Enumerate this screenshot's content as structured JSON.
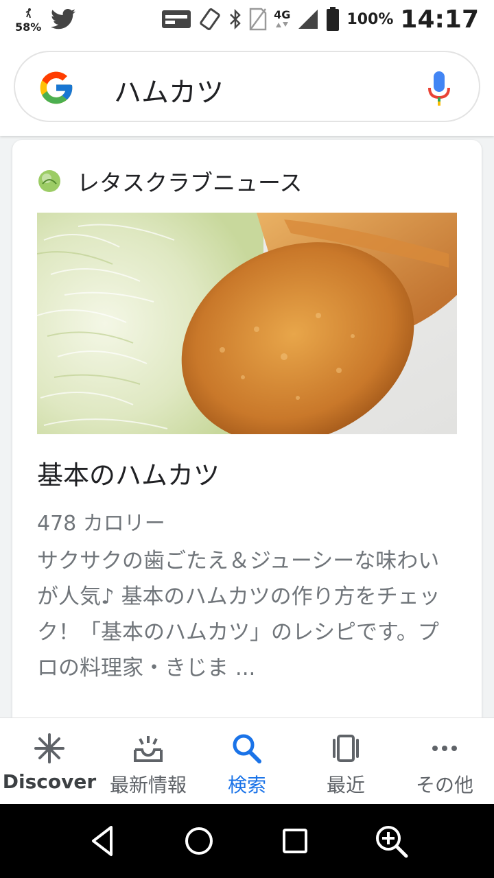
{
  "status_bar": {
    "left_indicator": "58%",
    "network_type": "4G",
    "battery_percent": "100%",
    "time": "14:17",
    "icons": [
      "runner-icon",
      "twitter-icon",
      "voicemail-icon",
      "vibrate-icon",
      "bluetooth-icon",
      "no-sim-icon",
      "signal-icon",
      "battery-icon"
    ]
  },
  "search": {
    "query": "ハムカツ",
    "logo": "google-g-icon",
    "mic": "mic-icon"
  },
  "card": {
    "source_name": "レタスクラブニュース",
    "source_icon": "lettuce-icon",
    "image": "fried-ham-cutlet-with-cabbage",
    "title": "基本のハムカツ",
    "calories": "478 カロリー",
    "description": "サクサクの歯ごたえ＆ジューシーな味わいが人気♪ 基本のハムカツの作り方をチェック！「基本のハムカツ」のレシピです。プロの料理家・きじま ..."
  },
  "tabs": [
    {
      "label": "Discover",
      "icon": "asterisk-icon"
    },
    {
      "label": "最新情報",
      "icon": "inbox-updates-icon"
    },
    {
      "label": "検索",
      "icon": "search-icon"
    },
    {
      "label": "最近",
      "icon": "recent-cards-icon"
    },
    {
      "label": "その他",
      "icon": "more-icon"
    }
  ],
  "active_tab": "検索",
  "colors": {
    "accent": "#1a73e8",
    "text_primary": "#202124",
    "text_secondary": "#70757a"
  }
}
